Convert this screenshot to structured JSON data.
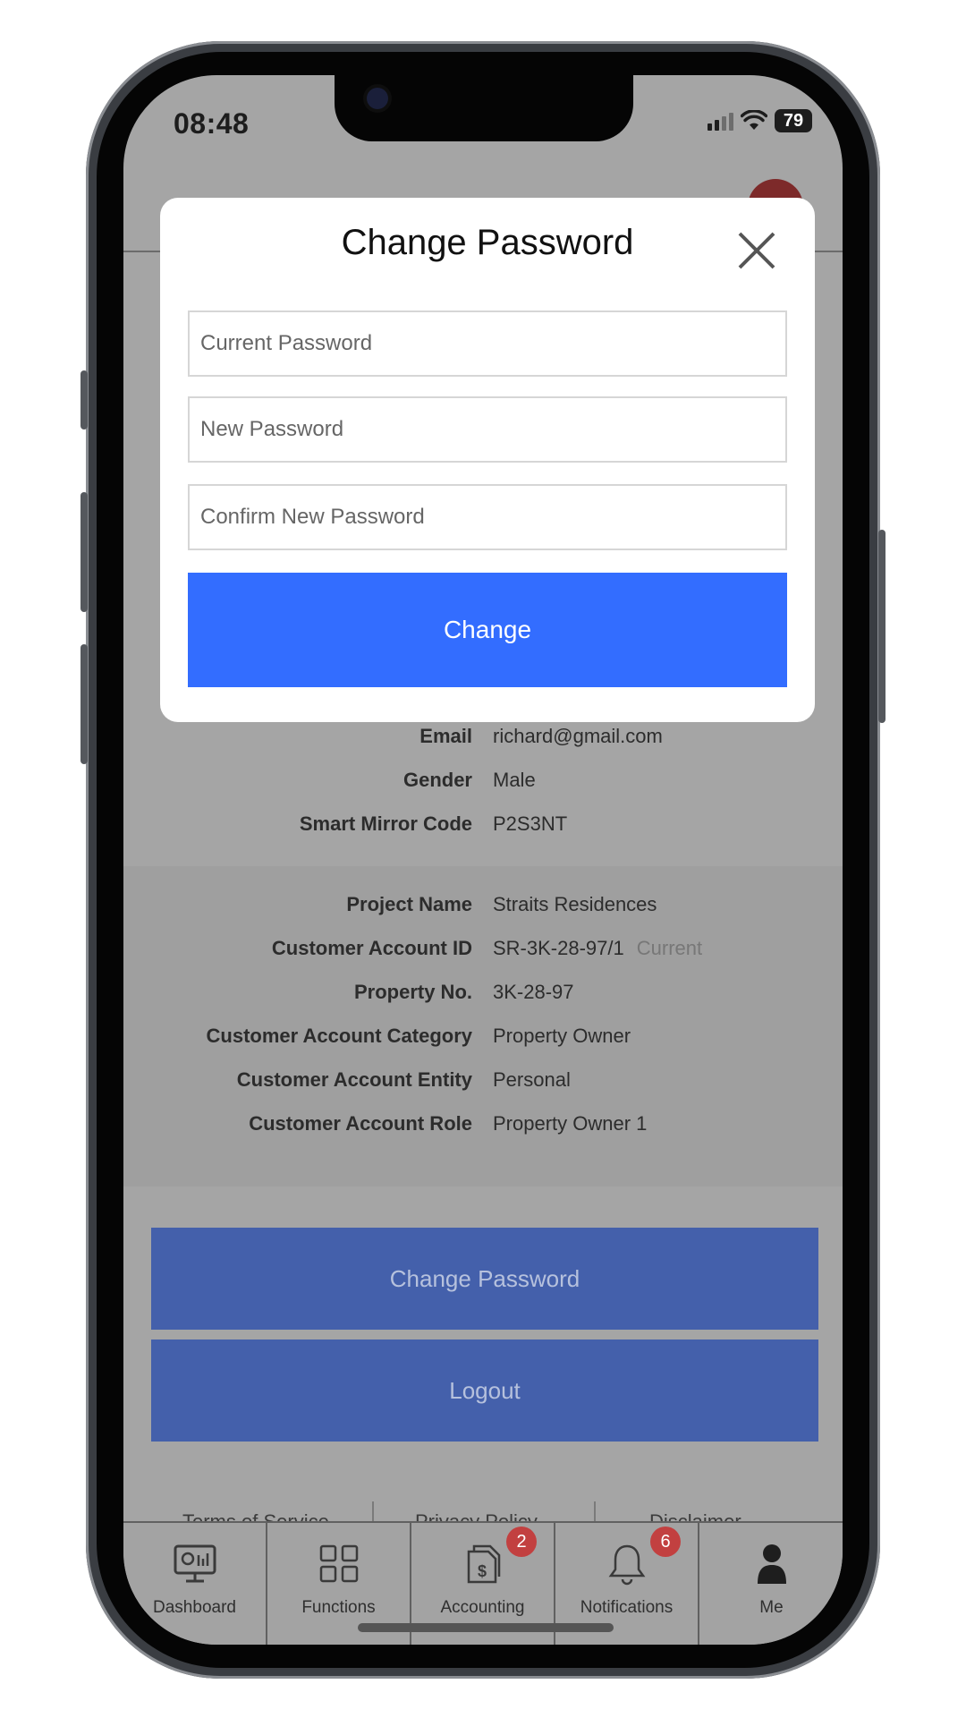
{
  "status_bar": {
    "time": "08:48",
    "battery": "79"
  },
  "modal": {
    "title": "Change Password",
    "fields": {
      "current_placeholder": "Current Password",
      "new_placeholder": "New Password",
      "confirm_placeholder": "Confirm New Password"
    },
    "submit_label": "Change"
  },
  "profile": {
    "email_label": "Email",
    "email_value": "richard@gmail.com",
    "gender_label": "Gender",
    "gender_value": "Male",
    "mirror_label": "Smart Mirror Code",
    "mirror_value": "P2S3NT"
  },
  "account": {
    "project_label": "Project Name",
    "project_value": "Straits Residences",
    "account_id_label": "Customer Account ID",
    "account_id_value": "SR-3K-28-97/1",
    "account_id_tag": "Current",
    "property_label": "Property No.",
    "property_value": "3K-28-97",
    "category_label": "Customer Account Category",
    "category_value": "Property Owner",
    "entity_label": "Customer Account Entity",
    "entity_value": "Personal",
    "role_label": "Customer Account Role",
    "role_value": "Property Owner 1"
  },
  "actions": {
    "change_password": "Change Password",
    "logout": "Logout"
  },
  "footer": {
    "terms": "Terms of Service",
    "privacy": "Privacy Policy",
    "disclaimer": "Disclaimer"
  },
  "tabs": [
    {
      "label": "Dashboard",
      "icon": "dashboard-icon"
    },
    {
      "label": "Functions",
      "icon": "grid-icon"
    },
    {
      "label": "Accounting",
      "icon": "invoice-icon",
      "badge": "2"
    },
    {
      "label": "Notifications",
      "icon": "bell-icon",
      "badge": "6"
    },
    {
      "label": "Me",
      "icon": "person-icon"
    }
  ],
  "colors": {
    "primary_button": "#336dff",
    "dimmed_button": "#4460ab",
    "badge": "#c24040",
    "overlay": "#a5a5a5"
  }
}
